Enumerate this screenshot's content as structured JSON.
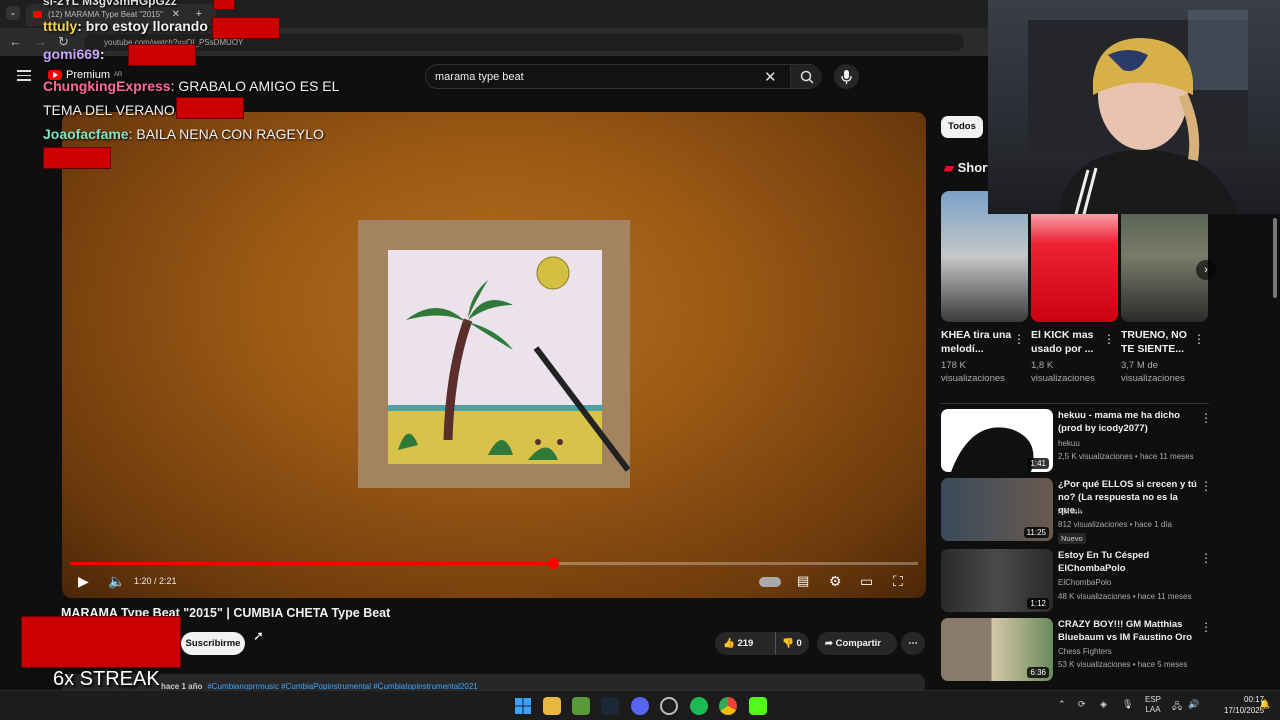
{
  "browser": {
    "tab_title": "(12) MARAMA Type Beat \"2015\"",
    "address": "youtube.com/watch?v=QI_PSsDMUOY"
  },
  "youtube": {
    "logo_text": "Premium",
    "logo_region": "AR",
    "search_value": "marama type beat"
  },
  "player": {
    "time": "1:20 / 2:21",
    "progress": 0.57
  },
  "video": {
    "title": "MARAMA Type Beat \"2015\" | CUMBIA CHETA Type Beat",
    "subscribe_label": "Suscribirme",
    "likes": "219",
    "dislikes": "0",
    "share_label": "Compartir",
    "date": "hace 1 año",
    "tags": "#Cumbianoprrmusic #CumbiaPopinstrumental #Cumbiatopinstrumental2021"
  },
  "chat": [
    {
      "user": "tttuly",
      "text": "bro estoy llorando",
      "color": "#f5d547"
    },
    {
      "user": "gomi669",
      "text": "",
      "color": "#c9a5ff"
    },
    {
      "user": "ChungkingExpress",
      "text": "GRABALO AMIGO ES EL TEMA DEL VERANO",
      "color": "#ff6a9a"
    },
    {
      "user": "Joaofacfame",
      "text": "BAILA NENA CON RAGEYLO",
      "color": "#7fe3c8"
    }
  ],
  "chat_top_fragment": "sl-2YL M3gv3mHGpGzz",
  "streak": "6x STREAK",
  "sidebar": {
    "chip": "Todos",
    "shorts_heading": "Shorts",
    "shorts": [
      {
        "title": "KHEA tira una melodí...",
        "views": "178 K visualizaciones"
      },
      {
        "title": "El KICK mas usado por ...",
        "views": "1,8 K visualizaciones"
      },
      {
        "title": "TRUENO, NO TE SIENTE...",
        "views": "3,7 M de visualizaciones"
      }
    ],
    "videos": [
      {
        "title": "hekuu - mama me ha dicho (prod by icody2077)",
        "channel": "hekuu",
        "meta": "2,5 K visualizaciones • hace 11 meses",
        "duration": "1:41",
        "badge": ""
      },
      {
        "title": "¿Por qué ELLOS si crecen y tú no? (La respuesta no es la que...",
        "channel": "Almich",
        "meta": "812 visualizaciones • hace 1 día",
        "duration": "11:25",
        "badge": "Nuevo"
      },
      {
        "title": "Estoy En Tu Césped ElChombaPolo",
        "channel": "ElChombaPolo",
        "meta": "48 K visualizaciones • hace 11 meses",
        "duration": "1:12",
        "badge": ""
      },
      {
        "title": "CRAZY BOY!!! GM Matthias Bluebaum vs IM Faustino Oro",
        "channel": "Chess Fighters",
        "meta": "53 K visualizaciones • hace 5 meses",
        "duration": "6:36",
        "badge": ""
      }
    ]
  },
  "taskbar": {
    "lang": "ESP",
    "lang2": "LAA",
    "time": "00:17",
    "date": "17/10/2025"
  }
}
